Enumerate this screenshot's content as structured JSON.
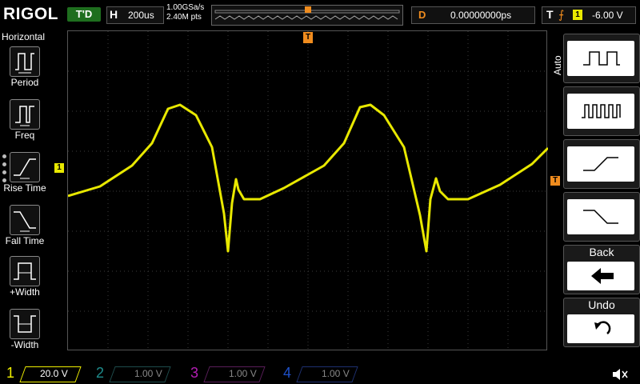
{
  "brand": "RIGOL",
  "top": {
    "run_state": "T'D",
    "timebase_label": "H",
    "timebase_value": "200us",
    "sample_rate": "1.00GSa/s",
    "memory_depth": "2.40M pts",
    "delay_label": "D",
    "delay_value": "0.00000000ps",
    "trigger_label": "T",
    "trigger_channel": "1",
    "trigger_level": "-6.00 V"
  },
  "left_panel": {
    "title": "Horizontal",
    "items": [
      {
        "label": "Period",
        "icon": "period-icon"
      },
      {
        "label": "Freq",
        "icon": "frequency-icon"
      },
      {
        "label": "Rise Time",
        "icon": "rise-time-icon"
      },
      {
        "label": "Fall Time",
        "icon": "fall-time-icon"
      },
      {
        "label": "+Width",
        "icon": "positive-width-icon"
      },
      {
        "label": "-Width",
        "icon": "negative-width-icon"
      }
    ]
  },
  "right_menu": {
    "mode": "Auto",
    "buttons": [
      {
        "icon": "square-wave-icon"
      },
      {
        "icon": "pulse-train-icon"
      },
      {
        "icon": "rising-edge-icon"
      },
      {
        "icon": "falling-edge-icon"
      },
      {
        "label": "Back",
        "icon": "back-arrow-icon"
      },
      {
        "label": "Undo",
        "icon": "undo-icon"
      }
    ]
  },
  "channels": [
    {
      "num": "1",
      "scale": "20.0 V",
      "color": "#f0f000"
    },
    {
      "num": "2",
      "scale": "1.00 V",
      "color": "#1e8c8c"
    },
    {
      "num": "3",
      "scale": "1.00 V",
      "color": "#b41eb4"
    },
    {
      "num": "4",
      "scale": "1.00 V",
      "color": "#1e50c8"
    }
  ],
  "colors": {
    "trace": "#e8e800",
    "trigger_marker": "#f08c1e",
    "grid": "#3a3a3a"
  },
  "ch1_marker": "1",
  "trigger_marker": "T"
}
